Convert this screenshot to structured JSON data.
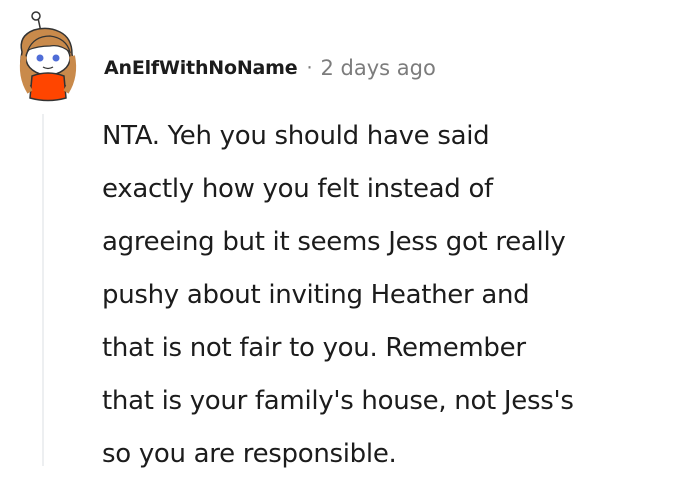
{
  "comment": {
    "author": "AnElfWithNoName",
    "separator": "·",
    "timestamp": "2 days ago",
    "avatar_icon": "snoo-avatar-icon",
    "body_lines": [
      "NTA. Yeh you should have said",
      "exactly how you felt instead of",
      "agreeing but it seems Jess got really",
      "pushy about inviting Heather and",
      "that is not fair to you. Remember",
      "that is your family's house, not Jess's",
      "so you are responsible."
    ]
  },
  "colors": {
    "text_primary": "#1c1c1c",
    "text_meta": "#7c7c7c",
    "thread_line": "#edeff1",
    "avatar_hair": "#c98a4b",
    "avatar_shirt": "#ff4500"
  }
}
